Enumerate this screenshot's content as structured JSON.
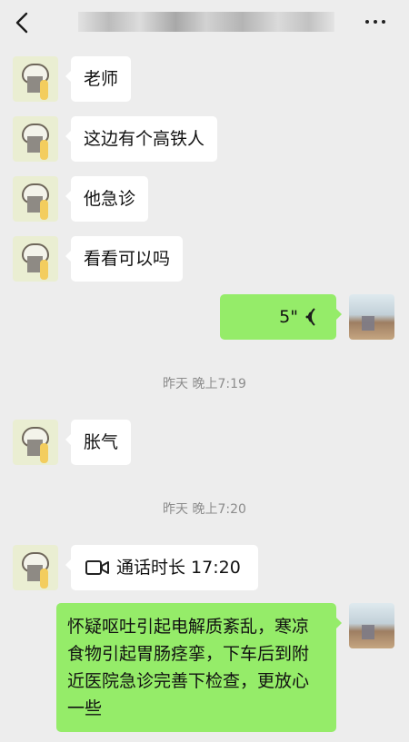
{
  "header": {
    "title": "...",
    "back_icon": "chevron-left-icon",
    "more_icon": "ellipsis-icon"
  },
  "messages": [
    {
      "from": "other",
      "text": "老师"
    },
    {
      "from": "other",
      "text": "这边有个高铁人"
    },
    {
      "from": "other",
      "text": "他急诊"
    },
    {
      "from": "other",
      "text": "看看可以吗"
    },
    {
      "from": "me",
      "type": "voice",
      "duration": "5\"",
      "icon": "voice-wave-icon"
    },
    {
      "type": "time",
      "text": "昨天 晚上7:19"
    },
    {
      "from": "other",
      "text": "胀气"
    },
    {
      "type": "time",
      "text": "昨天 晚上7:20"
    },
    {
      "from": "other",
      "type": "call",
      "icon": "video-call-icon",
      "text": "通话时长 17:20"
    },
    {
      "from": "me",
      "text": "怀疑呕吐引起电解质紊乱，寒凉食物引起胃肠痉挛，下车后到附近医院急诊完善下检查，更放心一些"
    }
  ],
  "colors": {
    "background": "#ededed",
    "bubble_self": "#95ec69",
    "bubble_other": "#ffffff",
    "timestamp_text": "#8c8c8c"
  }
}
